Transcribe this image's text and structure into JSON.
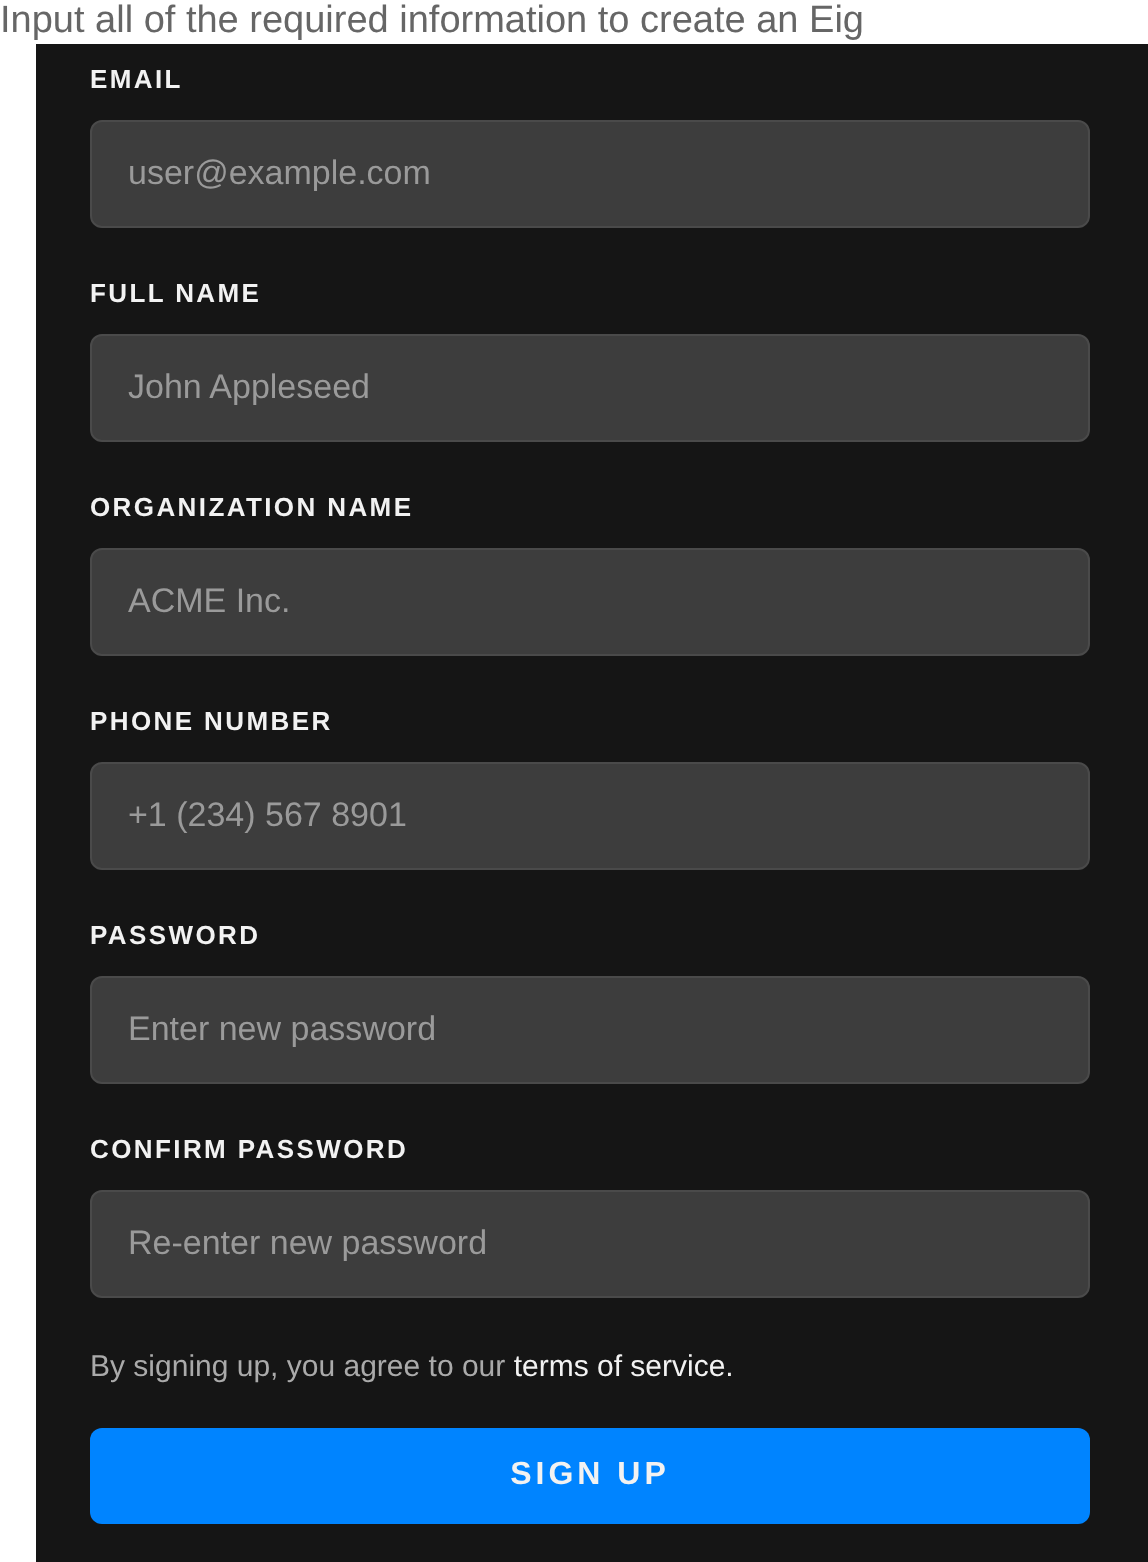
{
  "intro": "Input all of the required information to create an Eig",
  "fields": [
    {
      "label": "EMAIL",
      "placeholder": "user@example.com"
    },
    {
      "label": "FULL NAME",
      "placeholder": "John Appleseed"
    },
    {
      "label": "ORGANIZATION NAME",
      "placeholder": "ACME Inc."
    },
    {
      "label": "PHONE NUMBER",
      "placeholder": "+1 (234) 567 8901"
    },
    {
      "label": "PASSWORD",
      "placeholder": "Enter new password"
    },
    {
      "label": "CONFIRM PASSWORD",
      "placeholder": "Re-enter new password"
    }
  ],
  "terms": {
    "text": "By signing up, you agree to our ",
    "link": "terms of service."
  },
  "submit": "SIGN UP"
}
